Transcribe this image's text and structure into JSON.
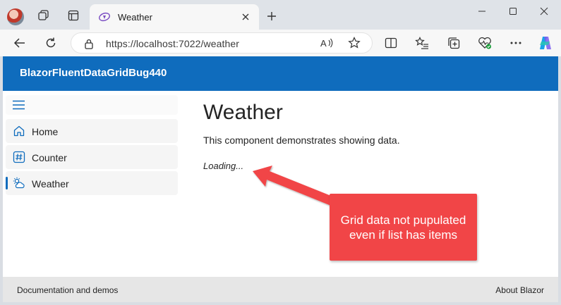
{
  "browser": {
    "tab": {
      "title": "Weather"
    },
    "address": {
      "url": "https://localhost:7022/weather"
    }
  },
  "app": {
    "brand": "BlazorFluentDataGridBug440",
    "nav": {
      "items": [
        {
          "label": "Home",
          "icon": "home-icon",
          "active": false
        },
        {
          "label": "Counter",
          "icon": "number-symbol-icon",
          "active": false
        },
        {
          "label": "Weather",
          "icon": "weather-partly-cloudy-icon",
          "active": true
        }
      ]
    },
    "page": {
      "title": "Weather",
      "description": "This component demonstrates showing data.",
      "loading": "Loading..."
    },
    "footer": {
      "left": "Documentation and demos",
      "right": "About Blazor"
    }
  },
  "annotation": {
    "text": "Grid data not pupulated even if list has items"
  },
  "colors": {
    "accent": "#0f6cbd",
    "callout": "#f14547"
  }
}
